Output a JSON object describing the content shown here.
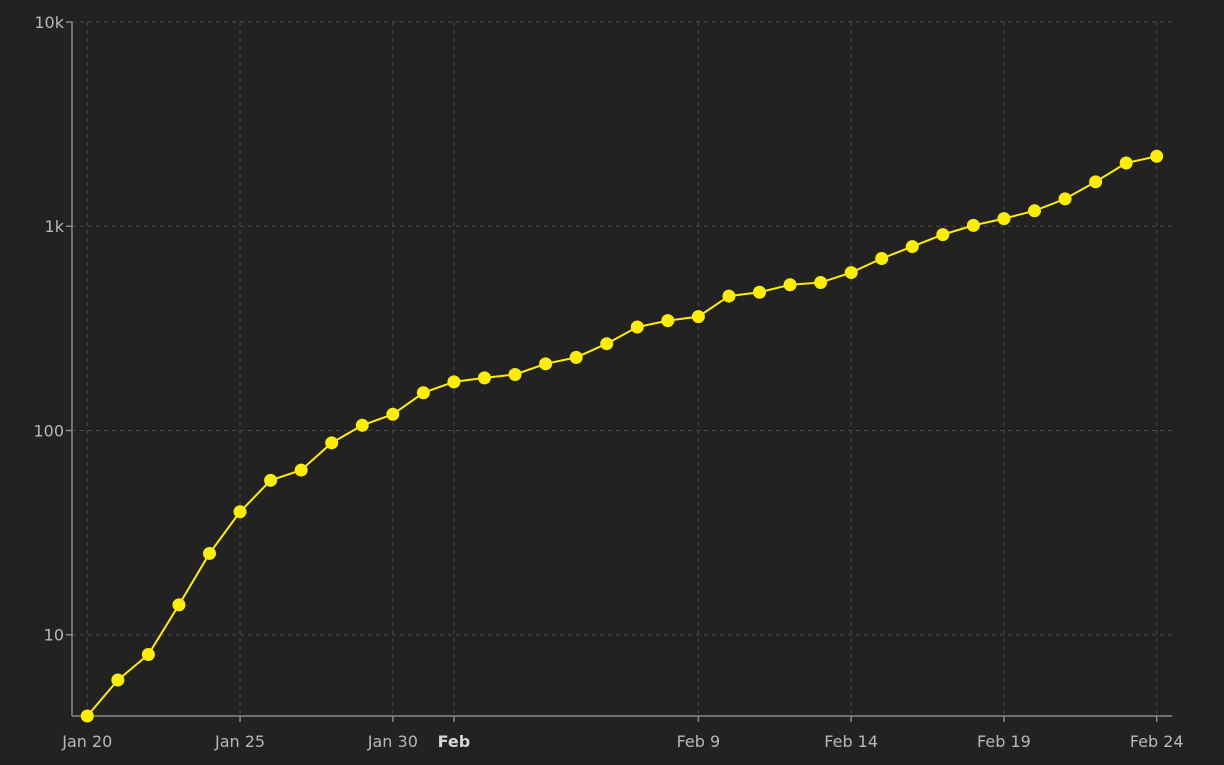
{
  "colors": {
    "background": "#222222",
    "series": "#ffee00",
    "grid": "#4a4a4a",
    "axis": "#8a8a8a",
    "tick_text": "#b8b8b8"
  },
  "chart_data": {
    "type": "line",
    "title": "",
    "xlabel": "",
    "ylabel": "",
    "y_scale": "log",
    "ylim": [
      4,
      10000
    ],
    "xlim": [
      "2020-01-20",
      "2020-02-24"
    ],
    "grid": true,
    "legend": "none",
    "y_ticks": [
      {
        "value": 10,
        "label": "10"
      },
      {
        "value": 100,
        "label": "100"
      },
      {
        "value": 1000,
        "label": "1k"
      },
      {
        "value": 10000,
        "label": "10k"
      }
    ],
    "x_ticks": [
      {
        "date": "2020-01-20",
        "label": "Jan 20",
        "major": false
      },
      {
        "date": "2020-01-25",
        "label": "Jan 25",
        "major": false
      },
      {
        "date": "2020-01-30",
        "label": "Jan 30",
        "major": false
      },
      {
        "date": "2020-02-01",
        "label": "Feb",
        "major": true
      },
      {
        "date": "2020-02-09",
        "label": "Feb 9",
        "major": false
      },
      {
        "date": "2020-02-14",
        "label": "Feb 14",
        "major": false
      },
      {
        "date": "2020-02-19",
        "label": "Feb 19",
        "major": false
      },
      {
        "date": "2020-02-24",
        "label": "Feb 24",
        "major": false
      }
    ],
    "series": [
      {
        "color": "#ffee00",
        "x": [
          "2020-01-20",
          "2020-01-21",
          "2020-01-22",
          "2020-01-23",
          "2020-01-24",
          "2020-01-25",
          "2020-01-26",
          "2020-01-27",
          "2020-01-28",
          "2020-01-29",
          "2020-01-30",
          "2020-01-31",
          "2020-02-01",
          "2020-02-02",
          "2020-02-03",
          "2020-02-04",
          "2020-02-05",
          "2020-02-06",
          "2020-02-07",
          "2020-02-08",
          "2020-02-09",
          "2020-02-10",
          "2020-02-11",
          "2020-02-12",
          "2020-02-13",
          "2020-02-14",
          "2020-02-15",
          "2020-02-16",
          "2020-02-17",
          "2020-02-18",
          "2020-02-19",
          "2020-02-20",
          "2020-02-21",
          "2020-02-22",
          "2020-02-23",
          "2020-02-24"
        ],
        "values": [
          4,
          6,
          8,
          14,
          25,
          40,
          57,
          64,
          87,
          106,
          120,
          153,
          173,
          181,
          188,
          212,
          228,
          266,
          321,
          345,
          361,
          455,
          475,
          517,
          530,
          593,
          695,
          795,
          910,
          1010,
          1090,
          1190,
          1361,
          1650,
          2040,
          2200
        ]
      }
    ]
  }
}
